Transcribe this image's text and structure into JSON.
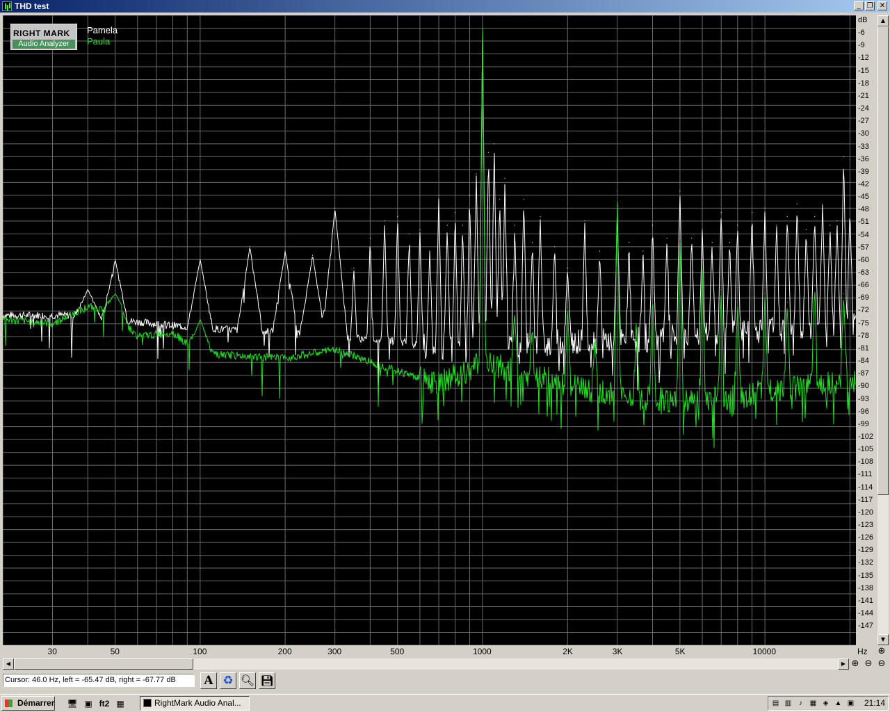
{
  "window": {
    "title": "THD test"
  },
  "logo": {
    "line1": "RIGHT MARK",
    "line2": "Audio Analyzer"
  },
  "legend": [
    {
      "name": "Pamela",
      "color": "#ffffff"
    },
    {
      "name": "Paula",
      "color": "#22e022"
    }
  ],
  "icons": {
    "app": "spectrum-icon",
    "minimize": "minimize-icon",
    "maximize": "restore-icon",
    "close": "close-icon"
  },
  "chart_data": {
    "type": "line",
    "xscale": "log",
    "xlim": [
      20,
      21000
    ],
    "ylim": [
      -150,
      -3
    ],
    "ylabel": "dB",
    "xlabel": "Hz",
    "grid": true,
    "yticks": [
      "dB",
      "-6",
      "-9",
      "-12",
      "-15",
      "-18",
      "-21",
      "-24",
      "-27",
      "-30",
      "-33",
      "-36",
      "-39",
      "-42",
      "-45",
      "-48",
      "-51",
      "-54",
      "-57",
      "-60",
      "-63",
      "-66",
      "-69",
      "-72",
      "-75",
      "-78",
      "-81",
      "-84",
      "-87",
      "-90",
      "-93",
      "-96",
      "-99",
      "-102",
      "-105",
      "-108",
      "-111",
      "-114",
      "-117",
      "-120",
      "-123",
      "-126",
      "-129",
      "-132",
      "-135",
      "-138",
      "-141",
      "-144",
      "-147"
    ],
    "xticks": [
      {
        "label": "30",
        "v": 30
      },
      {
        "label": "50",
        "v": 50
      },
      {
        "label": "100",
        "v": 100
      },
      {
        "label": "200",
        "v": 200
      },
      {
        "label": "300",
        "v": 300
      },
      {
        "label": "500",
        "v": 500
      },
      {
        "label": "1000",
        "v": 1000
      },
      {
        "label": "2K",
        "v": 2000
      },
      {
        "label": "3K",
        "v": 3000
      },
      {
        "label": "5K",
        "v": 5000
      },
      {
        "label": "10000",
        "v": 10000
      }
    ],
    "series": [
      {
        "name": "Pamela",
        "color": "#ffffff",
        "floor": [
          [
            20,
            -73
          ],
          [
            30,
            -73
          ],
          [
            40,
            -73
          ],
          [
            50,
            -74
          ],
          [
            70,
            -75
          ],
          [
            100,
            -76
          ],
          [
            200,
            -77
          ],
          [
            300,
            -78
          ],
          [
            500,
            -79
          ],
          [
            700,
            -81
          ],
          [
            1000,
            -81
          ],
          [
            1500,
            -80
          ],
          [
            2000,
            -79
          ],
          [
            3000,
            -79
          ],
          [
            5000,
            -78
          ],
          [
            8000,
            -77
          ],
          [
            12000,
            -76
          ],
          [
            21000,
            -75
          ]
        ],
        "peaks": [
          [
            40,
            -67
          ],
          [
            50,
            -60
          ],
          [
            100,
            -60
          ],
          [
            150,
            -57
          ],
          [
            200,
            -58
          ],
          [
            250,
            -59
          ],
          [
            300,
            -48
          ],
          [
            350,
            -62
          ],
          [
            400,
            -55
          ],
          [
            450,
            -51
          ],
          [
            500,
            -50
          ],
          [
            550,
            -54
          ],
          [
            600,
            -53
          ],
          [
            650,
            -58
          ],
          [
            700,
            -45
          ],
          [
            750,
            -52
          ],
          [
            800,
            -49
          ],
          [
            850,
            -52
          ],
          [
            900,
            -45
          ],
          [
            950,
            -40
          ],
          [
            1000,
            -7
          ],
          [
            1050,
            -35
          ],
          [
            1100,
            -33
          ],
          [
            1150,
            -46
          ],
          [
            1200,
            -41
          ],
          [
            1300,
            -52
          ],
          [
            1400,
            -46
          ],
          [
            1500,
            -56
          ],
          [
            1600,
            -50
          ],
          [
            1800,
            -57
          ],
          [
            2000,
            -62
          ],
          [
            2300,
            -51
          ],
          [
            2600,
            -58
          ],
          [
            3000,
            -49
          ],
          [
            3300,
            -56
          ],
          [
            3700,
            -58
          ],
          [
            4000,
            -52
          ],
          [
            4500,
            -55
          ],
          [
            5000,
            -44
          ],
          [
            5500,
            -55
          ],
          [
            6000,
            -53
          ],
          [
            6500,
            -56
          ],
          [
            7000,
            -49
          ],
          [
            7500,
            -56
          ],
          [
            8000,
            -52
          ],
          [
            9000,
            -49
          ],
          [
            10000,
            -48
          ],
          [
            11000,
            -52
          ],
          [
            12000,
            -50
          ],
          [
            13000,
            -47
          ],
          [
            14000,
            -53
          ],
          [
            15000,
            -50
          ],
          [
            16000,
            -47
          ],
          [
            17000,
            -52
          ],
          [
            18000,
            -51
          ],
          [
            19000,
            -36
          ],
          [
            20000,
            -48
          ]
        ]
      },
      {
        "name": "Paula",
        "color": "#22e022",
        "floor": [
          [
            20,
            -74
          ],
          [
            30,
            -75
          ],
          [
            40,
            -71
          ],
          [
            50,
            -72
          ],
          [
            60,
            -78
          ],
          [
            80,
            -77
          ],
          [
            100,
            -82
          ],
          [
            200,
            -83
          ],
          [
            300,
            -81
          ],
          [
            500,
            -86
          ],
          [
            700,
            -89
          ],
          [
            1000,
            -84
          ],
          [
            1500,
            -87
          ],
          [
            2000,
            -89
          ],
          [
            3000,
            -92
          ],
          [
            5000,
            -93
          ],
          [
            8000,
            -92
          ],
          [
            12000,
            -90
          ],
          [
            21000,
            -88
          ]
        ],
        "peaks": [
          [
            50,
            -68
          ],
          [
            100,
            -74
          ],
          [
            1000,
            -6
          ],
          [
            1300,
            -72
          ],
          [
            1500,
            -76
          ],
          [
            2000,
            -71
          ],
          [
            2500,
            -78
          ],
          [
            3000,
            -44
          ],
          [
            3500,
            -75
          ],
          [
            4000,
            -68
          ],
          [
            5000,
            -55
          ],
          [
            6000,
            -62
          ],
          [
            7000,
            -67
          ],
          [
            8000,
            -70
          ],
          [
            10000,
            -68
          ],
          [
            12000,
            -70
          ],
          [
            15000,
            -66
          ],
          [
            19000,
            -68
          ]
        ]
      }
    ]
  },
  "xaxis_unit": "Hz",
  "status": {
    "cursor_text": "Cursor:  46.0 Hz,  left = -65.47 dB,  right = -67.77 dB"
  },
  "toolbar": {
    "font_label": "A"
  },
  "taskbar": {
    "start_label": "Démarrer",
    "quicklaunch": [
      "desktop-icon",
      "media-icon",
      "ft2"
    ],
    "task_label": "RightMark Audio Anal...",
    "clock": "21:14"
  }
}
